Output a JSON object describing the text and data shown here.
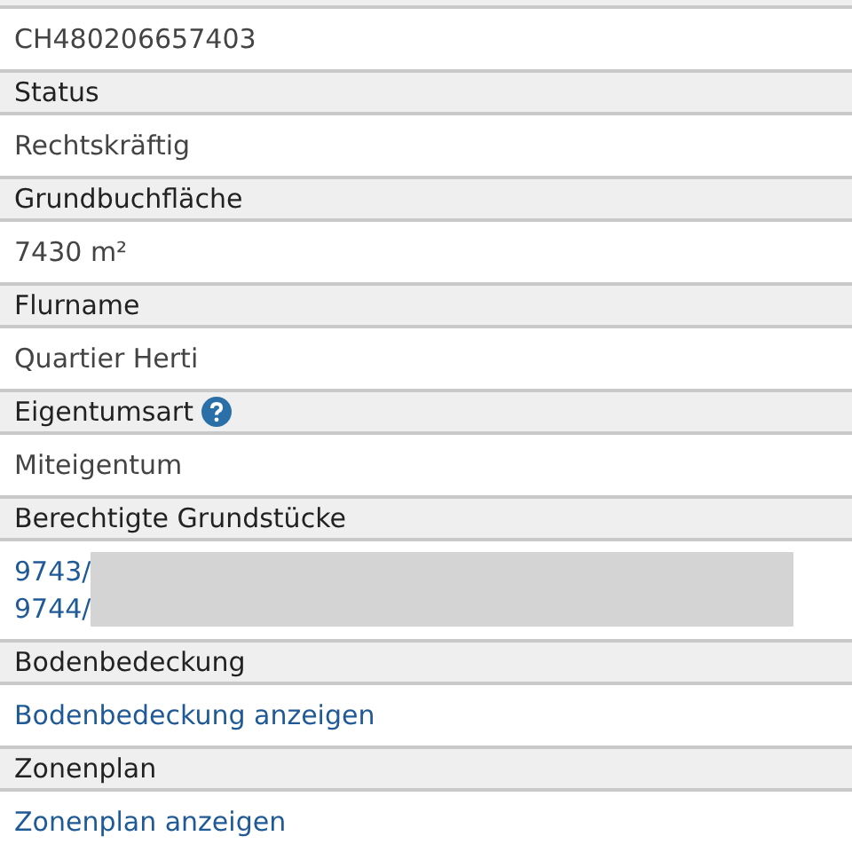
{
  "sections": [
    {
      "values": [
        {
          "kind": "text",
          "text": "CH480206657403"
        }
      ]
    },
    {
      "label": "Status",
      "values": [
        {
          "kind": "text",
          "text": "Rechtskräftig"
        }
      ]
    },
    {
      "label": "Grundbuchfläche",
      "values": [
        {
          "kind": "text",
          "text": "7430 m²"
        }
      ]
    },
    {
      "label": "Flurname",
      "values": [
        {
          "kind": "text",
          "text": "Quartier Herti"
        }
      ]
    },
    {
      "label": "Eigentumsart",
      "help": true,
      "values": [
        {
          "kind": "text",
          "text": "Miteigentum"
        }
      ]
    },
    {
      "label": "Berechtigte Grundstücke",
      "values": [
        {
          "kind": "redacted-link",
          "text": "9743/"
        },
        {
          "kind": "redacted-link",
          "text": "9744/"
        }
      ]
    },
    {
      "label": "Bodenbedeckung",
      "values": [
        {
          "kind": "link",
          "text": "Bodenbedeckung anzeigen"
        }
      ]
    },
    {
      "label": "Zonenplan",
      "values": [
        {
          "kind": "link",
          "text": "Zonenplan anzeigen"
        }
      ]
    }
  ]
}
